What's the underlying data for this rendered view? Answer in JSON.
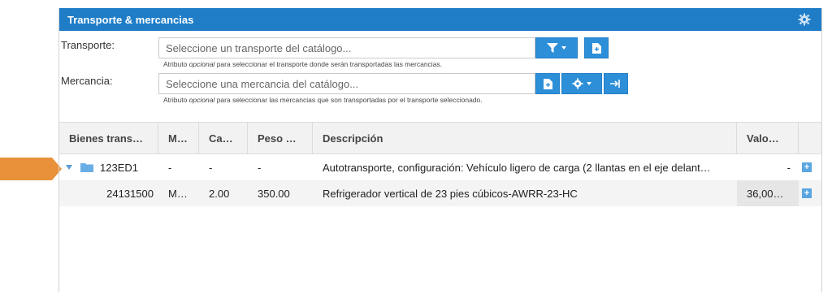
{
  "panel": {
    "title": "Transporte & mercancias",
    "settings_icon": "gear-icon"
  },
  "transport": {
    "label": "Transporte:",
    "placeholder": "Seleccione un transporte del catálogo...",
    "help_pre": "Atributo ",
    "help_em": "opcional",
    "help_post": " para seleccionar el transporte donde serán transportadas las mercancias.",
    "buttons": [
      "filter-icon",
      "new-document-icon"
    ]
  },
  "merchandise": {
    "label": "Mercancia:",
    "placeholder": "Seleccione una mercancia del catálogo...",
    "help_pre": "Atributo ",
    "help_em": "opcional",
    "help_post": " para seleccionar las mercancias que son transportadas por el transporte seleccionado.",
    "buttons": [
      "new-document-icon",
      "gear-icon",
      "export-icon"
    ]
  },
  "table": {
    "columns": [
      "Bienes trans…",
      "M…",
      "Ca…",
      "Peso …",
      "Descripción",
      "Valo…"
    ],
    "rows": [
      {
        "code": "123ED1",
        "m": "-",
        "ca": "-",
        "peso": "-",
        "descripcion": "Autotransporte, configuración: Vehículo ligero de carga (2 llantas en el eje delant…",
        "valor": "-"
      },
      {
        "code": "24131500",
        "m": "M…",
        "ca": "2.00",
        "peso": "350.00",
        "descripcion": "Refrigerador vertical de 23 pies cúbicos-AWRR-23-HC",
        "valor": "36,00…"
      }
    ],
    "row_action": "+"
  },
  "colors": {
    "header": "#1f7dc8",
    "button": "#2d8fd8",
    "marker": "#e8913a"
  }
}
